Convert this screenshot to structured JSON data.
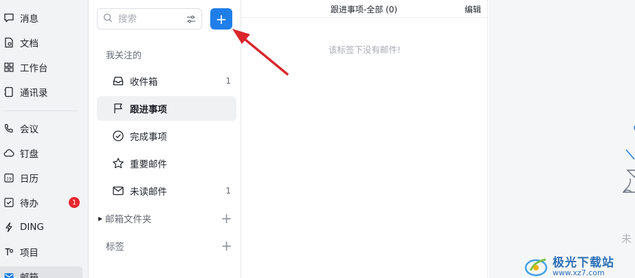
{
  "nav": {
    "items": [
      {
        "label": "消息",
        "icon": "message-icon"
      },
      {
        "label": "文档",
        "icon": "document-icon"
      },
      {
        "label": "工作台",
        "icon": "workbench-icon"
      },
      {
        "label": "通讯录",
        "icon": "contacts-icon"
      },
      {
        "label": "会议",
        "icon": "meeting-icon"
      },
      {
        "label": "钉盘",
        "icon": "cloud-drive-icon"
      },
      {
        "label": "日历",
        "icon": "calendar-icon"
      },
      {
        "label": "待办",
        "icon": "todo-icon"
      },
      {
        "label": "DING",
        "icon": "ding-icon"
      },
      {
        "label": "项目",
        "icon": "project-icon"
      },
      {
        "label": "邮箱",
        "icon": "mail-icon"
      }
    ],
    "todo_badge": "1"
  },
  "folders": {
    "search_placeholder": "搜索",
    "compose_label": "+",
    "following_title": "我关注的",
    "items": [
      {
        "label": "收件箱",
        "count": "1",
        "icon": "inbox-icon"
      },
      {
        "label": "跟进事项",
        "count": "",
        "icon": "flag-icon"
      },
      {
        "label": "完成事项",
        "count": "",
        "icon": "check-circle-icon"
      },
      {
        "label": "重要邮件",
        "count": "",
        "icon": "star-icon"
      },
      {
        "label": "未读邮件",
        "count": "1",
        "icon": "envelope-icon"
      }
    ],
    "mail_folders_label": "邮箱文件夹",
    "tags_label": "标签",
    "add_label": "+"
  },
  "list": {
    "title": "跟进事项-全部 (0)",
    "edit_label": "编辑",
    "empty_text": "该标签下没有邮件!"
  },
  "preview": {
    "text": "未"
  },
  "watermark": {
    "title": "极光下载站",
    "url": "www.xz7.com"
  },
  "colors": {
    "accent": "#1f7ee8",
    "badge": "#e8262b",
    "arrow": "#d9262b"
  }
}
